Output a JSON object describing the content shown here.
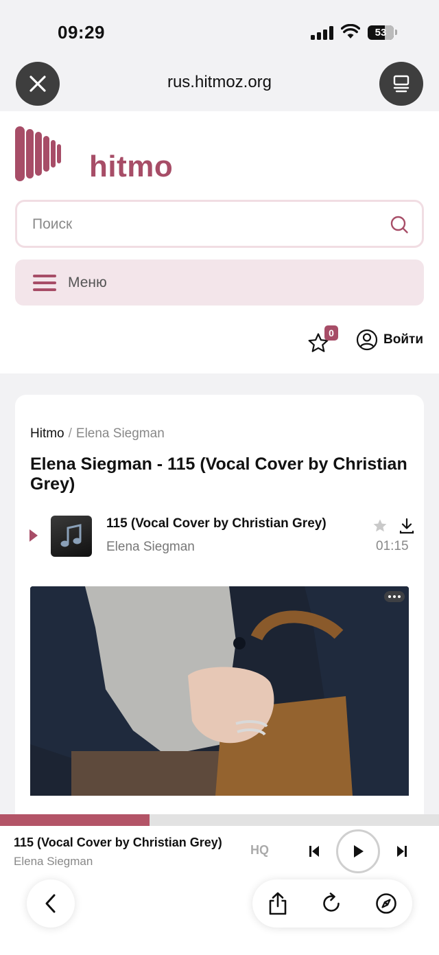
{
  "status_bar": {
    "time": "09:29",
    "battery": "53"
  },
  "browser": {
    "url": "rus.hitmoz.org",
    "icons": [
      "close-icon",
      "reader-icon",
      "chevron-left-icon",
      "share-icon",
      "reload-icon",
      "compass-icon"
    ]
  },
  "site": {
    "logo_text": "hitmo",
    "brand_color": "#a74d67",
    "search": {
      "placeholder": "Поиск",
      "value": ""
    },
    "menu_label": "Меню",
    "favorites_count": "0",
    "login_label": "Войти"
  },
  "breadcrumb": {
    "home": "Hitmo",
    "separator": "/",
    "current": "Elena Siegman"
  },
  "page_title": "Elena Siegman - 115 (Vocal Cover by Christian Grey)",
  "track": {
    "title": "115 (Vocal Cover by Christian Grey)",
    "artist": "Elena Siegman",
    "duration": "01:15"
  },
  "player": {
    "title": "115 (Vocal Cover by Christian Grey)",
    "artist": "Elena Siegman",
    "quality_label": "HQ",
    "progress": 0.34
  }
}
